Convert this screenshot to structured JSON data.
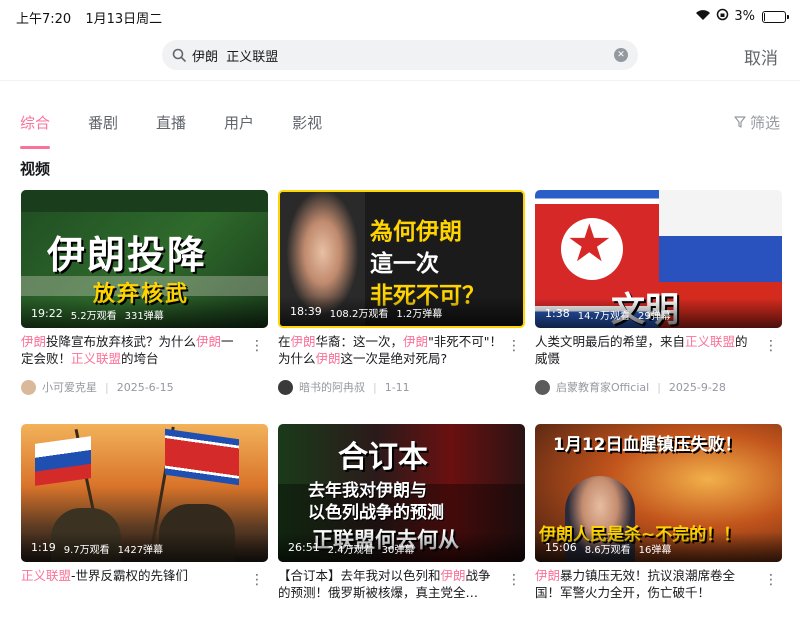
{
  "status_bar": {
    "time": "上午7:20",
    "date": "1月13日周二",
    "battery": "3%",
    "battery_level": 0.03
  },
  "search": {
    "query": "伊朗  正义联盟",
    "cancel_label": "取消"
  },
  "tabs": [
    {
      "label": "综合",
      "active": true
    },
    {
      "label": "番剧",
      "active": false
    },
    {
      "label": "直播",
      "active": false
    },
    {
      "label": "用户",
      "active": false
    },
    {
      "label": "影视",
      "active": false
    }
  ],
  "filter_label": "筛选",
  "section_title": "视频",
  "accent_color": "#fb7299",
  "videos": [
    {
      "duration": "19:22",
      "views": "5.2万观看",
      "danmaku": "331弹幕",
      "thumb_text": [
        "伊朗投降",
        "放弃核武"
      ],
      "title_parts": [
        {
          "text": "伊朗",
          "hl": true
        },
        {
          "text": "投降宣布放弃核武？为什么",
          "hl": false
        },
        {
          "text": "伊朗",
          "hl": true
        },
        {
          "text": "一定会败！",
          "hl": false
        },
        {
          "text": "正义联盟",
          "hl": true
        },
        {
          "text": "的垮台",
          "hl": false
        }
      ],
      "author": "小可爱克星",
      "date": "2025-6-15"
    },
    {
      "duration": "18:39",
      "views": "108.2万观看",
      "danmaku": "1.2万弹幕",
      "thumb_text": [
        "為何伊朗",
        "這一次",
        "非死不可？"
      ],
      "title_parts": [
        {
          "text": "在",
          "hl": false
        },
        {
          "text": "伊朗",
          "hl": true
        },
        {
          "text": "华裔：这一次，",
          "hl": false
        },
        {
          "text": "伊朗",
          "hl": true
        },
        {
          "text": "\"非死不可\"！为什么",
          "hl": false
        },
        {
          "text": "伊朗",
          "hl": true
        },
        {
          "text": "这一次是绝对死局?",
          "hl": false
        }
      ],
      "author": "暗书的阿冉叔",
      "date": "1-11"
    },
    {
      "duration": "1:38",
      "views": "14.7万观看",
      "danmaku": "29弹幕",
      "thumb_text": [
        "文明"
      ],
      "title_parts": [
        {
          "text": "人类文明最后的希望，来自",
          "hl": false
        },
        {
          "text": "正义联盟",
          "hl": true
        },
        {
          "text": "的威慑",
          "hl": false
        }
      ],
      "author": "启蒙教育家Official",
      "date": "2025-9-28"
    },
    {
      "duration": "1:19",
      "views": "9.7万观看",
      "danmaku": "1427弹幕",
      "thumb_text": [],
      "title_parts": [
        {
          "text": "正义联盟",
          "hl": true
        },
        {
          "text": "-世界反霸权的先锋们",
          "hl": false
        }
      ],
      "author": "",
      "date": ""
    },
    {
      "duration": "26:51",
      "views": "2.4万观看",
      "danmaku": "30弹幕",
      "thumb_text": [
        "合订本",
        "去年我对伊朗与",
        "以色列战争的预测",
        "正联盟何去何从"
      ],
      "title_parts": [
        {
          "text": "【合订本】去年我对以色列和",
          "hl": false
        },
        {
          "text": "伊朗",
          "hl": true
        },
        {
          "text": "战争的预测！俄罗斯被核爆，真主党全…",
          "hl": false
        }
      ],
      "author": "",
      "date": ""
    },
    {
      "duration": "15:06",
      "views": "8.6万观看",
      "danmaku": "16弹幕",
      "thumb_text": [
        "1月12日血腥镇压失败！",
        "伊朗人民是杀~不完的！！"
      ],
      "title_parts": [
        {
          "text": "伊朗",
          "hl": true
        },
        {
          "text": "暴力镇压无效！抗议浪潮席卷全国！军警火力全开，伤亡破千！",
          "hl": false
        }
      ],
      "author": "",
      "date": ""
    }
  ]
}
